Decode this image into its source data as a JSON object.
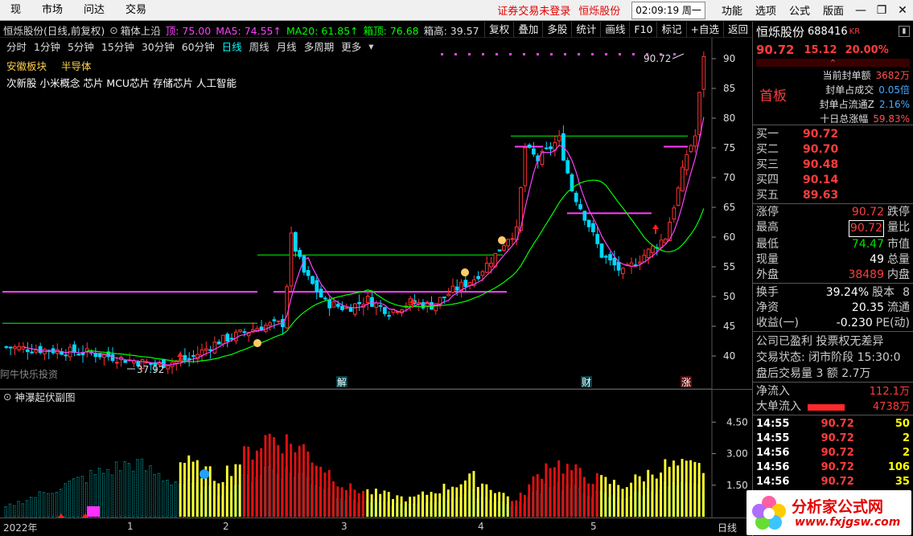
{
  "menu": {
    "left": [
      "现",
      "市场",
      "问达",
      "交易"
    ],
    "alert": "证券交易未登录",
    "alert_stock": "恒烁股份",
    "clock": "02:09:19 周一",
    "right": [
      "功能",
      "选项",
      "公式",
      "版面"
    ]
  },
  "chart_header": {
    "title": "恒烁股份(日线,前复权)",
    "indicator": "箱体上沿",
    "items": [
      {
        "text": "顶: 75.00",
        "color": "#ff40ff"
      },
      {
        "text": "MA5: 74.55↑",
        "color": "#ff40ff"
      },
      {
        "text": "MA20: 61.85↑",
        "color": "#00ff00"
      },
      {
        "text": "箱顶: 76.68",
        "color": "#00ff00"
      },
      {
        "text": "箱高: 39.57",
        "color": "#dddddd"
      }
    ],
    "tools": [
      "复权",
      "叠加",
      "多股",
      "统计",
      "画线",
      "F10",
      "标记",
      "+自选",
      "返回"
    ]
  },
  "periods": [
    "分时",
    "1分钟",
    "5分钟",
    "15分钟",
    "30分钟",
    "60分钟",
    "日线",
    "周线",
    "月线",
    "多周期",
    "更多"
  ],
  "active_period": "日线",
  "sectors": [
    "安徽板块",
    "半导体"
  ],
  "concepts": "次新股 小米概念 芯片 MCU芯片 存储芯片 人工智能",
  "watermark": "阿牛快乐投资",
  "annotations": {
    "high": "90.72",
    "low": "37.92"
  },
  "markers": [
    "解",
    "财",
    "涨"
  ],
  "sub_title": "神瀑起伏副图",
  "sub_ticks": [
    "4.50",
    "3.00",
    "1.50"
  ],
  "period_footer": "日线",
  "chart_data": {
    "type": "candlestick",
    "y_ticks": [
      90,
      85,
      80,
      75,
      70,
      65,
      60,
      55,
      50,
      45,
      40
    ],
    "ylim": [
      37,
      92
    ],
    "x_labels": [
      "2022年",
      "1",
      "2",
      "3",
      "4",
      "5"
    ],
    "ma_labels": [
      "MA5",
      "MA20"
    ]
  },
  "quote": {
    "name": "恒烁股份",
    "code": "688416",
    "suffix": "KR",
    "price": "90.72",
    "change": "15.12",
    "pct": "20.00%",
    "board": "首板",
    "stats": [
      {
        "label": "当前封单额",
        "value": "3682万"
      },
      {
        "label": "封单占成交",
        "value": "0.05倍"
      },
      {
        "label": "封单占流通Z",
        "value": "2.16%"
      },
      {
        "label": "十日总涨幅",
        "value": "59.83%"
      }
    ],
    "bids": [
      {
        "label": "买一",
        "value": "90.72"
      },
      {
        "label": "买二",
        "value": "90.70"
      },
      {
        "label": "买三",
        "value": "90.48"
      },
      {
        "label": "买四",
        "value": "90.14"
      },
      {
        "label": "买五",
        "value": "89.63"
      }
    ],
    "limit_up_label": "涨停",
    "limit_up": "90.72",
    "limit_down_label": "跌停",
    "high_label": "最高",
    "high": "90.72",
    "vol_ratio_label": "量比",
    "low_label": "最低",
    "low": "74.47",
    "mkt_value_label": "市值",
    "cur_vol_label": "现量",
    "cur_vol": "49",
    "total_vol_label": "总量",
    "outer_label": "外盘",
    "outer": "38489",
    "inner_label": "内盘",
    "turnover_label": "换手",
    "turnover": "39.24%",
    "equity_label": "股本",
    "equity_suffix": "8",
    "nav_label": "净资",
    "nav": "20.35",
    "float_label": "流通",
    "eps_label": "收益(一)",
    "eps": "-0.230",
    "pe_label": "PE(动)",
    "status1": "公司已盈利  投票权无差异",
    "status2": "交易状态: 闭市阶段 15:30:0",
    "status3": "盘后交易量 3 额 2.7万",
    "inflow_label": "净流入",
    "inflow": "112.1万",
    "big_label": "大单流入",
    "big": "4738万",
    "ticks": [
      {
        "t": "14:55",
        "p": "90.72",
        "v": "50"
      },
      {
        "t": "14:55",
        "p": "90.72",
        "v": "2"
      },
      {
        "t": "14:56",
        "p": "90.72",
        "v": "2"
      },
      {
        "t": "14:56",
        "p": "90.72",
        "v": "106"
      },
      {
        "t": "14:56",
        "p": "90.72",
        "v": "35"
      }
    ]
  },
  "logo": {
    "text": "分析家公式网",
    "url": "www.fxjgsw.com"
  }
}
